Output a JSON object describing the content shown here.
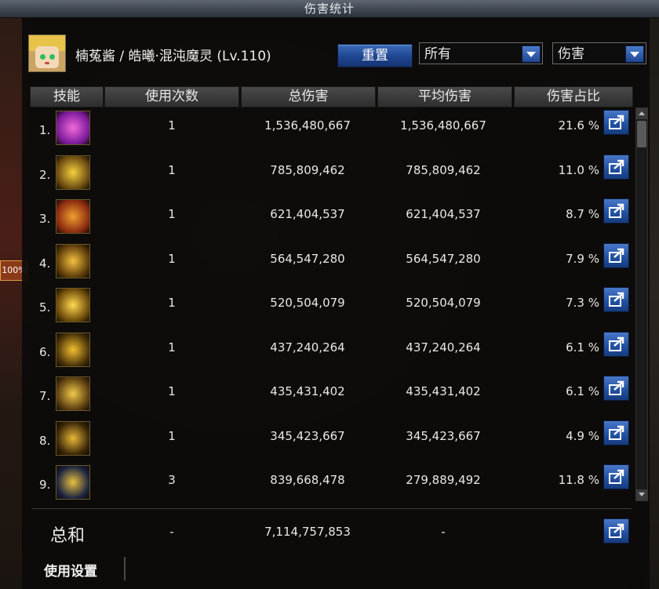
{
  "window": {
    "title": "伤害统计"
  },
  "header": {
    "player": "楠菟酱 / 皓曦·混沌魔灵 (Lv.110)",
    "reset_button": "重置",
    "filter_select": "所有",
    "mode_select": "伤害"
  },
  "columns": [
    "技能",
    "使用次数",
    "总伤害",
    "平均伤害",
    "伤害占比"
  ],
  "rows": [
    {
      "idx": "1.",
      "count": "1",
      "total": "1,536,480,667",
      "avg": "1,536,480,667",
      "pct": "21.6 %",
      "icon": "skill-icon-1"
    },
    {
      "idx": "2.",
      "count": "1",
      "total": "785,809,462",
      "avg": "785,809,462",
      "pct": "11.0 %",
      "icon": "skill-icon-2"
    },
    {
      "idx": "3.",
      "count": "1",
      "total": "621,404,537",
      "avg": "621,404,537",
      "pct": "8.7 %",
      "icon": "skill-icon-3"
    },
    {
      "idx": "4.",
      "count": "1",
      "total": "564,547,280",
      "avg": "564,547,280",
      "pct": "7.9 %",
      "icon": "skill-icon-4"
    },
    {
      "idx": "5.",
      "count": "1",
      "total": "520,504,079",
      "avg": "520,504,079",
      "pct": "7.3 %",
      "icon": "skill-icon-5"
    },
    {
      "idx": "6.",
      "count": "1",
      "total": "437,240,264",
      "avg": "437,240,264",
      "pct": "6.1 %",
      "icon": "skill-icon-6"
    },
    {
      "idx": "7.",
      "count": "1",
      "total": "435,431,402",
      "avg": "435,431,402",
      "pct": "6.1 %",
      "icon": "skill-icon-7"
    },
    {
      "idx": "8.",
      "count": "1",
      "total": "345,423,667",
      "avg": "345,423,667",
      "pct": "4.9 %",
      "icon": "skill-icon-8"
    },
    {
      "idx": "9.",
      "count": "3",
      "total": "839,668,478",
      "avg": "279,889,492",
      "pct": "11.8 %",
      "icon": "skill-icon-9"
    }
  ],
  "summary": {
    "label": "总和",
    "count": "-",
    "total": "7,114,757,853",
    "avg": "-"
  },
  "footer": {
    "settings_label": "使用设置"
  },
  "side_badge": "100%",
  "colors": {
    "accent_blue": "#2150a0",
    "gold": "#d4a017"
  }
}
